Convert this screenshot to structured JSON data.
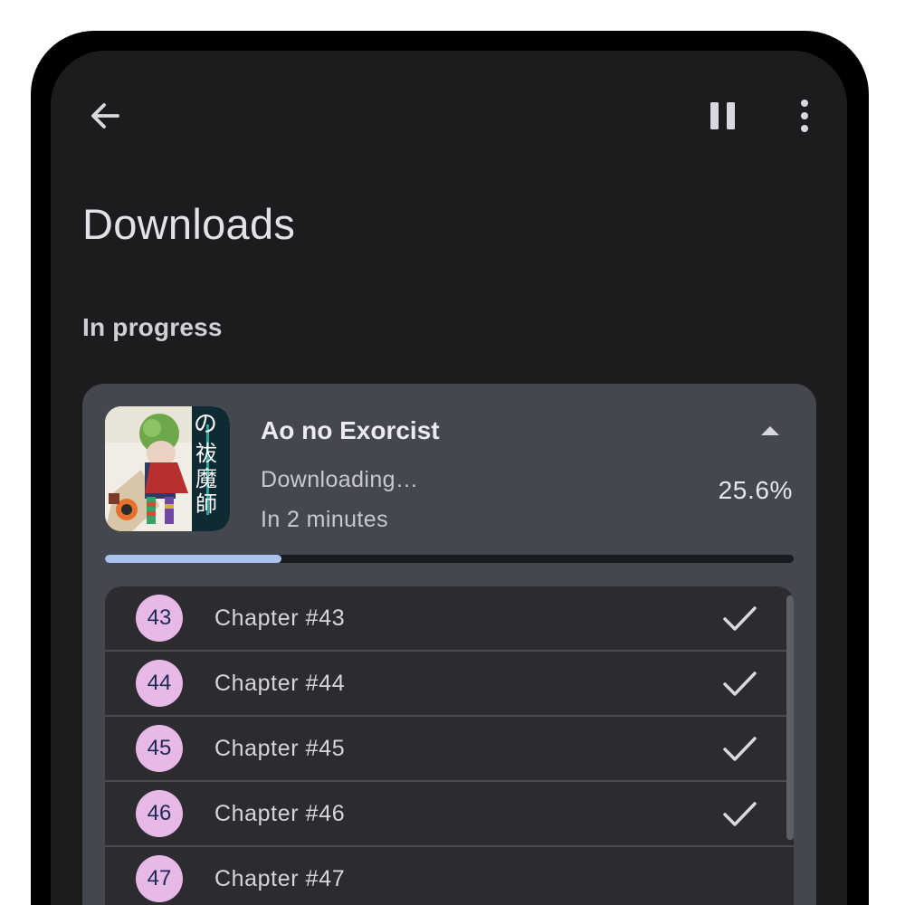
{
  "header": {
    "back_icon": "arrow-back-icon",
    "pause_icon": "pause-icon",
    "more_icon": "more-vert-icon"
  },
  "page_title": "Downloads",
  "section_label": "In progress",
  "download": {
    "title": "Ao no Exorcist",
    "status": "Downloading…",
    "eta": "In 2 minutes",
    "percent_label": "25.6%",
    "progress": 0.256,
    "collapse_icon": "caret-up-icon",
    "cover_text": "の祓魔師"
  },
  "chapters": [
    {
      "badge": "43",
      "label": "Chapter #43",
      "done": true
    },
    {
      "badge": "44",
      "label": "Chapter #44",
      "done": true
    },
    {
      "badge": "45",
      "label": "Chapter #45",
      "done": true
    },
    {
      "badge": "46",
      "label": "Chapter #46",
      "done": true
    },
    {
      "badge": "47",
      "label": "Chapter #47",
      "done": false
    }
  ],
  "colors": {
    "background": "#1c1c1f",
    "card": "#45474f",
    "progress_fill": "#a9c4f0",
    "badge": "#e8b9e6",
    "badge_text": "#1d2a55"
  }
}
